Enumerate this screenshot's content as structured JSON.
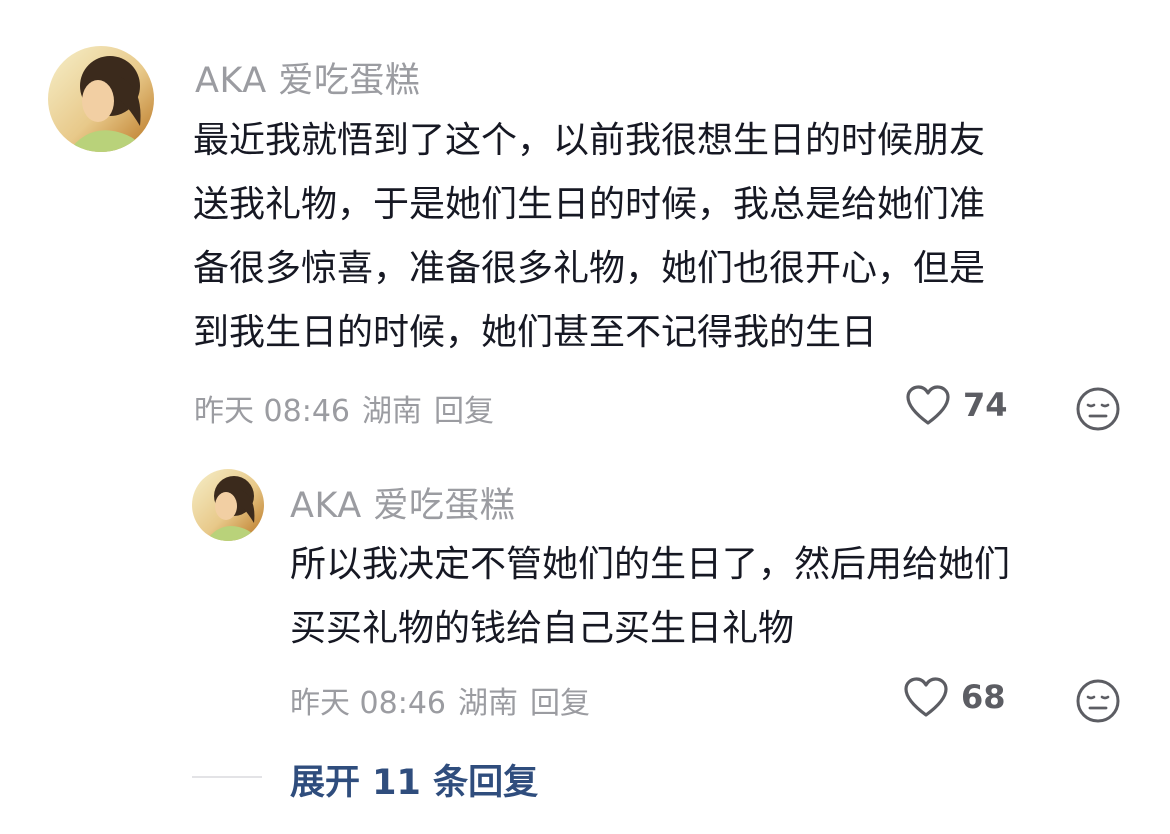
{
  "comment": {
    "username": "AKA 爱吃蛋糕",
    "text": "最近我就悟到了这个，以前我很想生日的时候朋友\n送我礼物，于是她们生日的时候，我总是给她们准\n备很多惊喜，准备很多礼物，她们也很开心，但是\n到我生日的时候，她们甚至不记得我的生日",
    "time": "昨天 08:46",
    "location": "湖南",
    "reply_label": "回复",
    "likes": "74",
    "like_icon": "heart-outline-icon",
    "dislike_icon": "meh-face-icon"
  },
  "reply": {
    "username": "AKA 爱吃蛋糕",
    "text": "所以我决定不管她们的生日了，然后用给她们\n买买礼物的钱给自己买生日礼物",
    "time": "昨天 08:46",
    "location": "湖南",
    "reply_label": "回复",
    "likes": "68",
    "like_icon": "heart-outline-icon",
    "dislike_icon": "meh-face-icon"
  },
  "expand": {
    "label": "展开 11 条回复"
  },
  "colors": {
    "text_primary": "#161823",
    "text_secondary": "#9b9ca1",
    "link": "#2f4d7d",
    "icon": "#5c5d63"
  }
}
